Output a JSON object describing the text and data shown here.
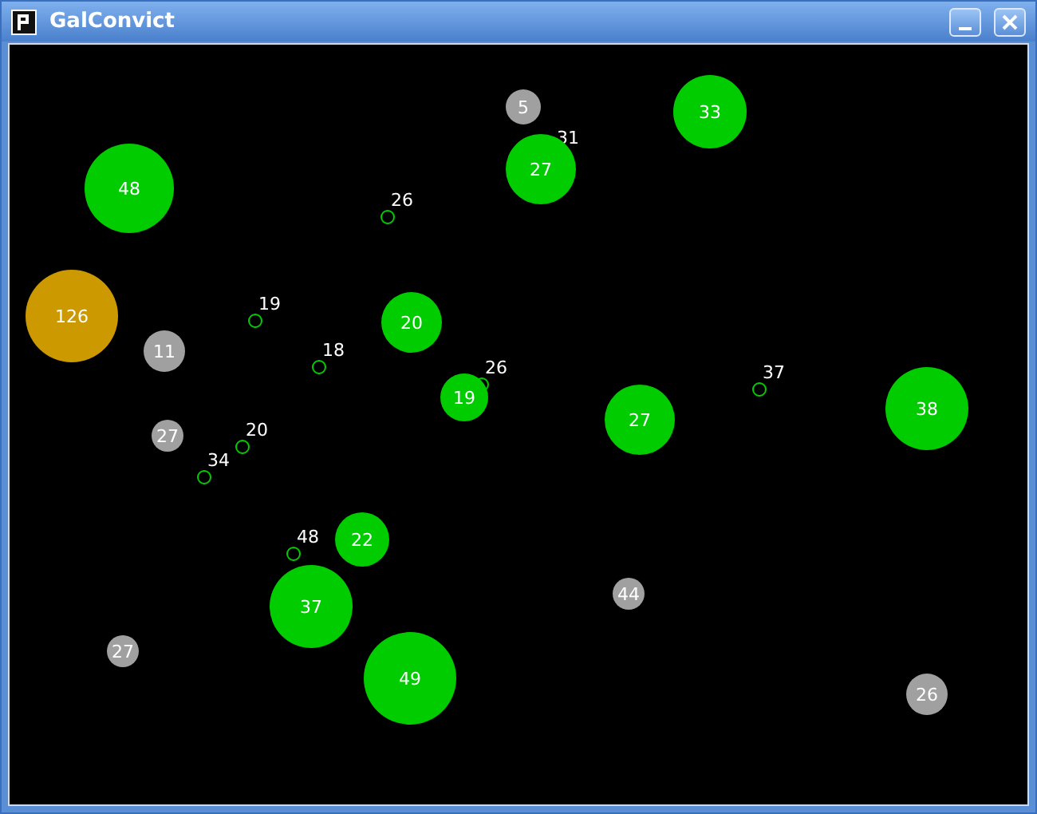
{
  "window": {
    "title": "GalConvict"
  },
  "planets": [
    {
      "label": "5",
      "color": "#a0a0a0"
    },
    {
      "label": "33",
      "color": "#00cc00"
    },
    {
      "label": "27",
      "color": "#00cc00"
    },
    {
      "label": "48",
      "color": "#00cc00"
    },
    {
      "label": "126",
      "color": "#cc9900"
    },
    {
      "label": "11",
      "color": "#a0a0a0"
    },
    {
      "label": "20",
      "color": "#00cc00"
    },
    {
      "label": "19",
      "color": "#00cc00"
    },
    {
      "label": "27",
      "color": "#00cc00"
    },
    {
      "label": "38",
      "color": "#00cc00"
    },
    {
      "label": "27",
      "color": "#a0a0a0"
    },
    {
      "label": "22",
      "color": "#00cc00"
    },
    {
      "label": "37",
      "color": "#00cc00"
    },
    {
      "label": "44",
      "color": "#a0a0a0"
    },
    {
      "label": "27",
      "color": "#a0a0a0"
    },
    {
      "label": "49",
      "color": "#00cc00"
    },
    {
      "label": "26",
      "color": "#a0a0a0"
    }
  ],
  "fleets": [
    {
      "label": "31"
    },
    {
      "label": "26"
    },
    {
      "label": "19"
    },
    {
      "label": "18"
    },
    {
      "label": "26"
    },
    {
      "label": "37"
    },
    {
      "label": "20"
    },
    {
      "label": "34"
    },
    {
      "label": "48"
    }
  ]
}
